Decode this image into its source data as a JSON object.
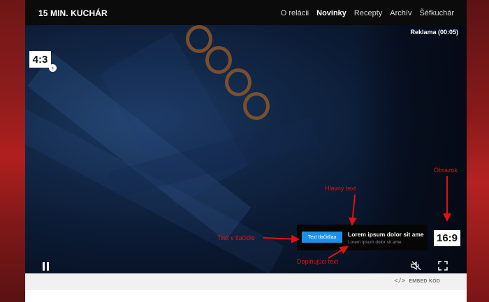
{
  "colors": {
    "side_background": "#a01d1d",
    "topbar": "#0b0b0b",
    "ad_button": "#1d8fe6",
    "annotation": "#e01111"
  },
  "header": {
    "brand": "15 MIN. KUCHÁR",
    "nav": [
      {
        "label": "O relácii",
        "active": false
      },
      {
        "label": "Novinky",
        "active": true
      },
      {
        "label": "Recepty",
        "active": false
      },
      {
        "label": "Archív",
        "active": false
      },
      {
        "label": "Šéfkuchár",
        "active": false
      }
    ]
  },
  "player": {
    "ad_label": "Reklama (00:05)",
    "ratio_small": "4:3",
    "ratio_small_arrow_icon": "chevron-right-icon",
    "banner": {
      "button_label": "Text tlačidlaa",
      "main_text": "Lorem ipsum dolor sit ame",
      "sub_text": "Lorem ipsum dolor sit ame"
    },
    "ratio_big": "16:9",
    "controls": {
      "pause_icon": "pause-icon",
      "mute_icon": "speaker-muted-icon",
      "fullscreen_icon": "fullscreen-icon"
    }
  },
  "footer": {
    "embed_icon": "</>",
    "embed_label": "EMBED KÓD"
  },
  "annotations": {
    "obrazok": "Obrázok",
    "hlavny_text": "Hlavný text",
    "text_v_tlacidle": "Text v tlačidle",
    "doplnujuci_text": "Doplňujúci text"
  }
}
